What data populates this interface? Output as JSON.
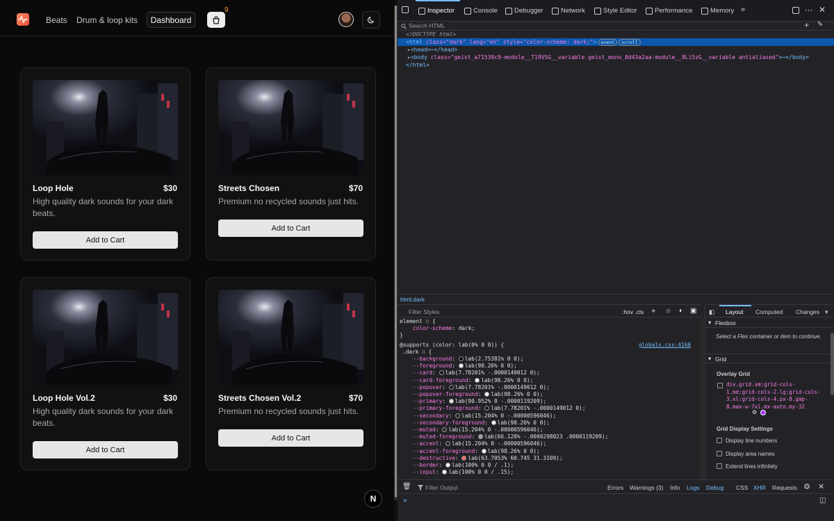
{
  "app": {
    "nav": {
      "links": [
        "Beats",
        "Drum & loop kits"
      ],
      "dashboard_label": "Dashboard",
      "cart_count": "9"
    },
    "cards": [
      {
        "title": "Loop Hole",
        "price": "$30",
        "description": "High quality dark sounds for your dark beats.",
        "button": "Add to Cart"
      },
      {
        "title": "Streets Chosen",
        "price": "$70",
        "description": "Premium no recycled sounds just hits.",
        "button": "Add to Cart"
      },
      {
        "title": "Loop Hole Vol.2",
        "price": "$30",
        "description": "High quality dark sounds for your dark beats.",
        "button": "Add to Cart"
      },
      {
        "title": "Streets Chosen Vol.2",
        "price": "$70",
        "description": "Premium no recycled sounds just hits.",
        "button": "Add to Cart"
      }
    ],
    "next_badge": "N"
  },
  "devtools": {
    "tabs": [
      "Inspector",
      "Console",
      "Debugger",
      "Network",
      "Style Editor",
      "Performance",
      "Memory"
    ],
    "search_placeholder": "Search HTML",
    "tree": {
      "doctype": "<!DOCTYPE html>",
      "html_open": "<html",
      "html_attrs": " class=\"dark\" lang=\"en\" style=\"color-scheme: dark;\"",
      "html_close": ">",
      "badge_event": "event",
      "badge_scroll": "scroll",
      "head": "<head>⋯</head>",
      "body_open": "<body",
      "body_attrs": " class=\"geist_a71539c9-module__T19VSG__variable geist_mono_8d43a2aa-module__8Li5zG__variable antialiased\"",
      "body_close": ">⋯</body>",
      "html_end": "</html>"
    },
    "breadcrumb": "html.dark",
    "rules": {
      "filter_placeholder": "Filter Styles",
      "toolbar": ":hov  .cls",
      "element_header": "element ∷ {",
      "element_prop": "color-scheme",
      "element_value": "dark;",
      "close": "}",
      "supports": "@supports (color: lab(0% 0 0)) {",
      "source": "globals.css:4168",
      "dark_selector": ".dark ∷ {",
      "vars": [
        {
          "name": "--background",
          "value": "lab(2.75381% 0 0);",
          "swatch": "#070707"
        },
        {
          "name": "--foreground",
          "value": "lab(98.26% 0 0);",
          "swatch": "#fafafa"
        },
        {
          "name": "--card",
          "value": "lab(7.78201% -.0000149012 0);",
          "swatch": "#141414"
        },
        {
          "name": "--card-foreground",
          "value": "lab(98.26% 0 0);",
          "swatch": "#fafafa"
        },
        {
          "name": "--popover",
          "value": "lab(7.78201% -.0000149012 0);",
          "swatch": "#141414"
        },
        {
          "name": "--popover-foreground",
          "value": "lab(98.26% 0 0);",
          "swatch": "#fafafa"
        },
        {
          "name": "--primary",
          "value": "lab(90.952% 0 -.0000119209);",
          "swatch": "#e5e5e5"
        },
        {
          "name": "--primary-foreground",
          "value": "lab(7.78201% -.0000149012 0);",
          "swatch": "#141414"
        },
        {
          "name": "--secondary",
          "value": "lab(15.204% 0 -.00000596046);",
          "swatch": "#262626"
        },
        {
          "name": "--secondary-foreground",
          "value": "lab(98.26% 0 0);",
          "swatch": "#fafafa"
        },
        {
          "name": "--muted",
          "value": "lab(15.204% 0 -.00000596046);",
          "swatch": "#262626"
        },
        {
          "name": "--muted-foreground",
          "value": "lab(66.128% -.0000298023 .0000119209);",
          "swatch": "#a1a1a1"
        },
        {
          "name": "--accent",
          "value": "lab(15.204% 0 -.00000596046);",
          "swatch": "#262626"
        },
        {
          "name": "--accent-foreground",
          "value": "lab(98.26% 0 0);",
          "swatch": "#fafafa"
        },
        {
          "name": "--destructive",
          "value": "lab(63.7053% 60.745 31.3109);",
          "swatch": "#ff6467"
        },
        {
          "name": "--border",
          "value": "lab(100% 0 0 / .1);",
          "swatch": "#ffffff"
        },
        {
          "name": "--input",
          "value": "lab(100% 0 0 / .15);",
          "swatch": "#ffffff"
        }
      ]
    },
    "sidebar": {
      "tabs": [
        "Layout",
        "Computed",
        "Changes"
      ],
      "flexbox_title": "Flexbox",
      "flexbox_hint": "Select a Flex container or item to continue.",
      "grid_title": "Grid",
      "overlay_grid": "Overlay Grid",
      "grid_item": "div.grid.sm:grid-cols-1.md:grid-cols-2.lg:grid-cols-3.xl:grid-cols-4.px-8.gap-8.max-w-7xl.mx-auto.my-32",
      "display_settings": "Grid Display Settings",
      "options": [
        "Display line numbers",
        "Display area names",
        "Extend lines infinitely"
      ]
    },
    "console": {
      "filter_placeholder": "Filter Output",
      "levels": [
        "Errors",
        "Warnings (3)",
        "Info",
        "Logs",
        "Debug"
      ],
      "types": [
        "CSS",
        "XHR",
        "Requests"
      ],
      "prompt": "»"
    }
  },
  "colors": {
    "accent_blue": "#75bfff",
    "selection": "#0b58ad",
    "cart_count": "#ff9933",
    "logo": "#f04e37"
  }
}
